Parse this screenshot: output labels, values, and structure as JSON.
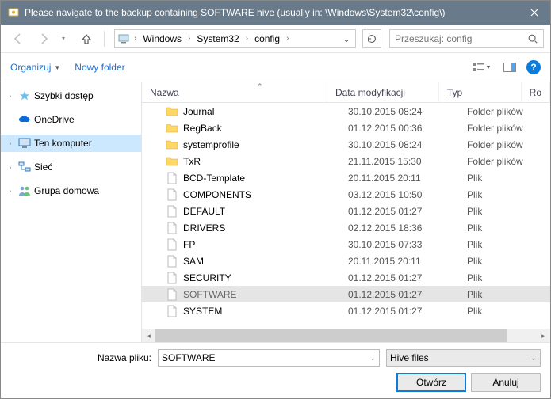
{
  "titlebar": {
    "title": "Please navigate to the backup containing SOFTWARE hive (usually in: \\Windows\\System32\\config\\)"
  },
  "breadcrumbs": [
    "Windows",
    "System32",
    "config"
  ],
  "search": {
    "placeholder": "Przeszukaj: config"
  },
  "toolbar": {
    "organize": "Organizuj",
    "newfolder": "Nowy folder"
  },
  "nav": {
    "quick": "Szybki dostęp",
    "onedrive": "OneDrive",
    "thispc": "Ten komputer",
    "network": "Sieć",
    "homegroup": "Grupa domowa"
  },
  "columns": {
    "name": "Nazwa",
    "date": "Data modyfikacji",
    "type": "Typ",
    "size": "Ro"
  },
  "files": [
    {
      "name": "Journal",
      "date": "30.10.2015 08:24",
      "type": "Folder plików",
      "icon": "folder"
    },
    {
      "name": "RegBack",
      "date": "01.12.2015 00:36",
      "type": "Folder plików",
      "icon": "folder"
    },
    {
      "name": "systemprofile",
      "date": "30.10.2015 08:24",
      "type": "Folder plików",
      "icon": "folder"
    },
    {
      "name": "TxR",
      "date": "21.11.2015 15:30",
      "type": "Folder plików",
      "icon": "folder"
    },
    {
      "name": "BCD-Template",
      "date": "20.11.2015 20:11",
      "type": "Plik",
      "icon": "file"
    },
    {
      "name": "COMPONENTS",
      "date": "03.12.2015 10:50",
      "type": "Plik",
      "icon": "file"
    },
    {
      "name": "DEFAULT",
      "date": "01.12.2015 01:27",
      "type": "Plik",
      "icon": "file"
    },
    {
      "name": "DRIVERS",
      "date": "02.12.2015 18:36",
      "type": "Plik",
      "icon": "file"
    },
    {
      "name": "FP",
      "date": "30.10.2015 07:33",
      "type": "Plik",
      "icon": "file"
    },
    {
      "name": "SAM",
      "date": "20.11.2015 20:11",
      "type": "Plik",
      "icon": "file"
    },
    {
      "name": "SECURITY",
      "date": "01.12.2015 01:27",
      "type": "Plik",
      "icon": "file"
    },
    {
      "name": "SOFTWARE",
      "date": "01.12.2015 01:27",
      "type": "Plik",
      "icon": "file",
      "selected": true
    },
    {
      "name": "SYSTEM",
      "date": "01.12.2015 01:27",
      "type": "Plik",
      "icon": "file"
    }
  ],
  "bottom": {
    "filename_label": "Nazwa pliku:",
    "filename_value": "SOFTWARE",
    "filter": "Hive files",
    "open": "Otwórz",
    "cancel": "Anuluj"
  }
}
